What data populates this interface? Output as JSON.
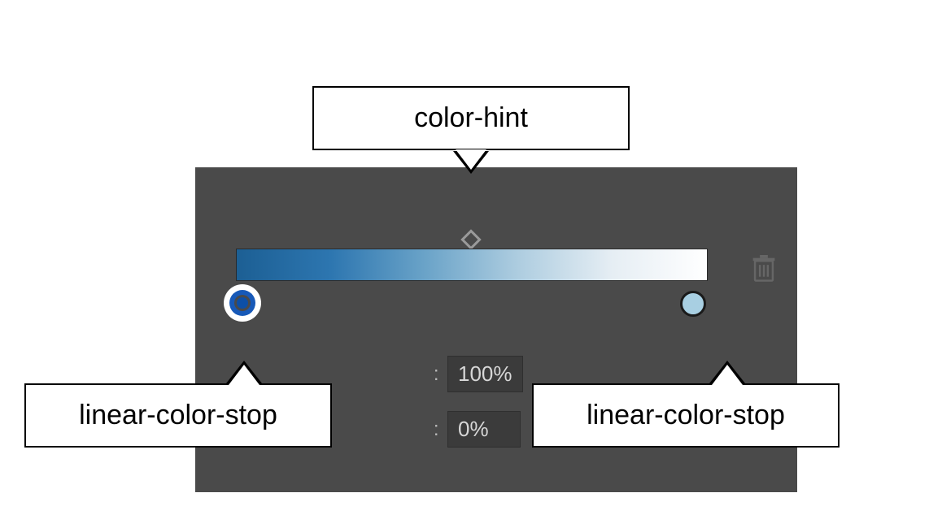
{
  "callouts": {
    "top": "color-hint",
    "bottomLeft": "linear-color-stop",
    "bottomRight": "linear-color-stop"
  },
  "gradient": {
    "startColor": "#1c5f94",
    "endColor": "#ffffff",
    "hintPositionPercent": 50
  },
  "inputs": {
    "row1Suffix": ":",
    "row1Value": "100%",
    "row2Suffix": ":",
    "row2Value": "0%"
  }
}
